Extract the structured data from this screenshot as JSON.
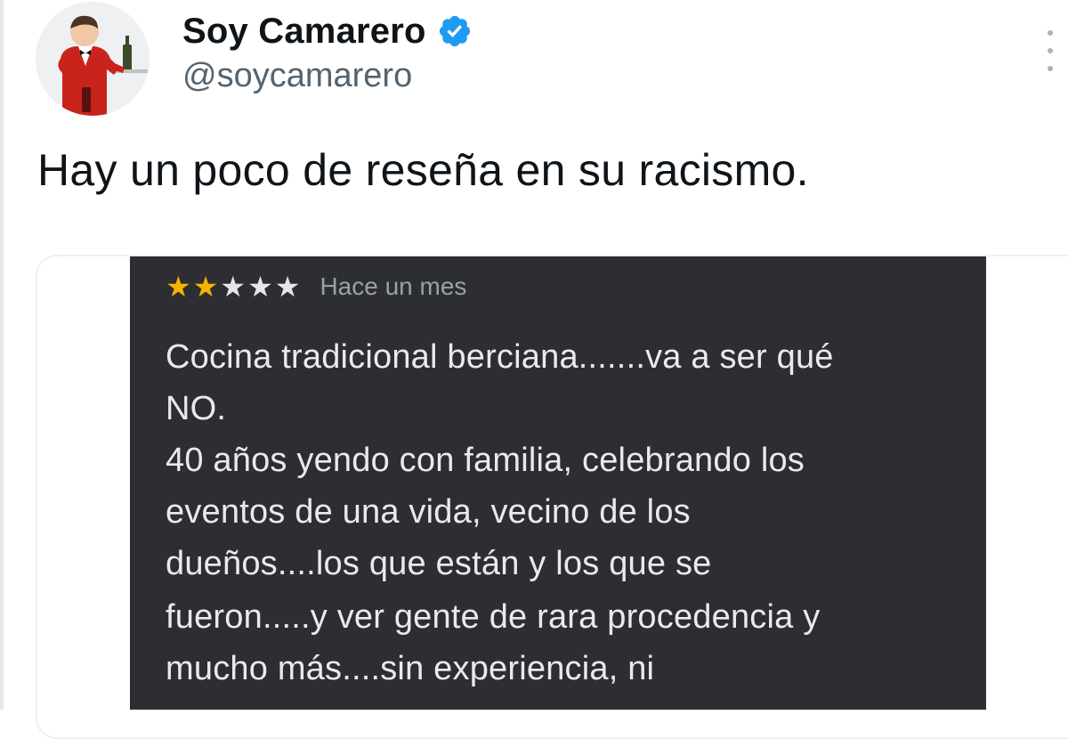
{
  "tweet": {
    "display_name": "Soy Camarero",
    "handle": "@soycamarero",
    "text": "Hay un poco de reseña en su racismo."
  },
  "review": {
    "rating": 2,
    "max_rating": 5,
    "date": "Hace un mes",
    "lines": [
      "Cocina tradicional berciana.......va a ser qué",
      "NO.",
      "40 años yendo con familia, celebrando los",
      "eventos de una vida, vecino de los",
      "dueños....los que están y los que se",
      "fueron.....y ver gente de rara procedencia y",
      "mucho más....sin experiencia, ni"
    ]
  },
  "colors": {
    "verified_badge": "#1d9bf0",
    "review_background": "#2d2e31",
    "star_filled": "#f4b400",
    "star_empty": "#e6e6e6"
  },
  "icons": {
    "verified": "verified-badge-icon",
    "more": "more-options-icon",
    "star": "star-icon"
  }
}
